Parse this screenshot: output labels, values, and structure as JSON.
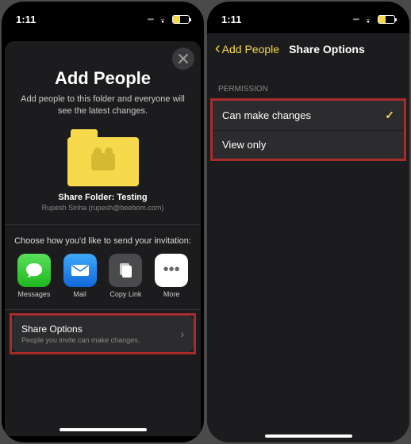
{
  "status": {
    "time": "1:11"
  },
  "screen1": {
    "title": "Add People",
    "subtitle": "Add people to this folder and everyone will see the latest changes.",
    "folder": {
      "name": "Share Folder: Testing",
      "owner": "Rupesh Sinha (rupesh@beebom.com)"
    },
    "inviteLabel": "Choose how you'd like to send your invitation:",
    "shareMethods": [
      {
        "label": "Messages"
      },
      {
        "label": "Mail"
      },
      {
        "label": "Copy Link"
      },
      {
        "label": "More"
      }
    ],
    "options": {
      "title": "Share Options",
      "subtitle": "People you invite can make changes."
    }
  },
  "screen2": {
    "back": "Add People",
    "title": "Share Options",
    "sectionHeader": "Permission",
    "permissions": [
      {
        "label": "Can make changes",
        "selected": true
      },
      {
        "label": "View only",
        "selected": false
      }
    ]
  }
}
